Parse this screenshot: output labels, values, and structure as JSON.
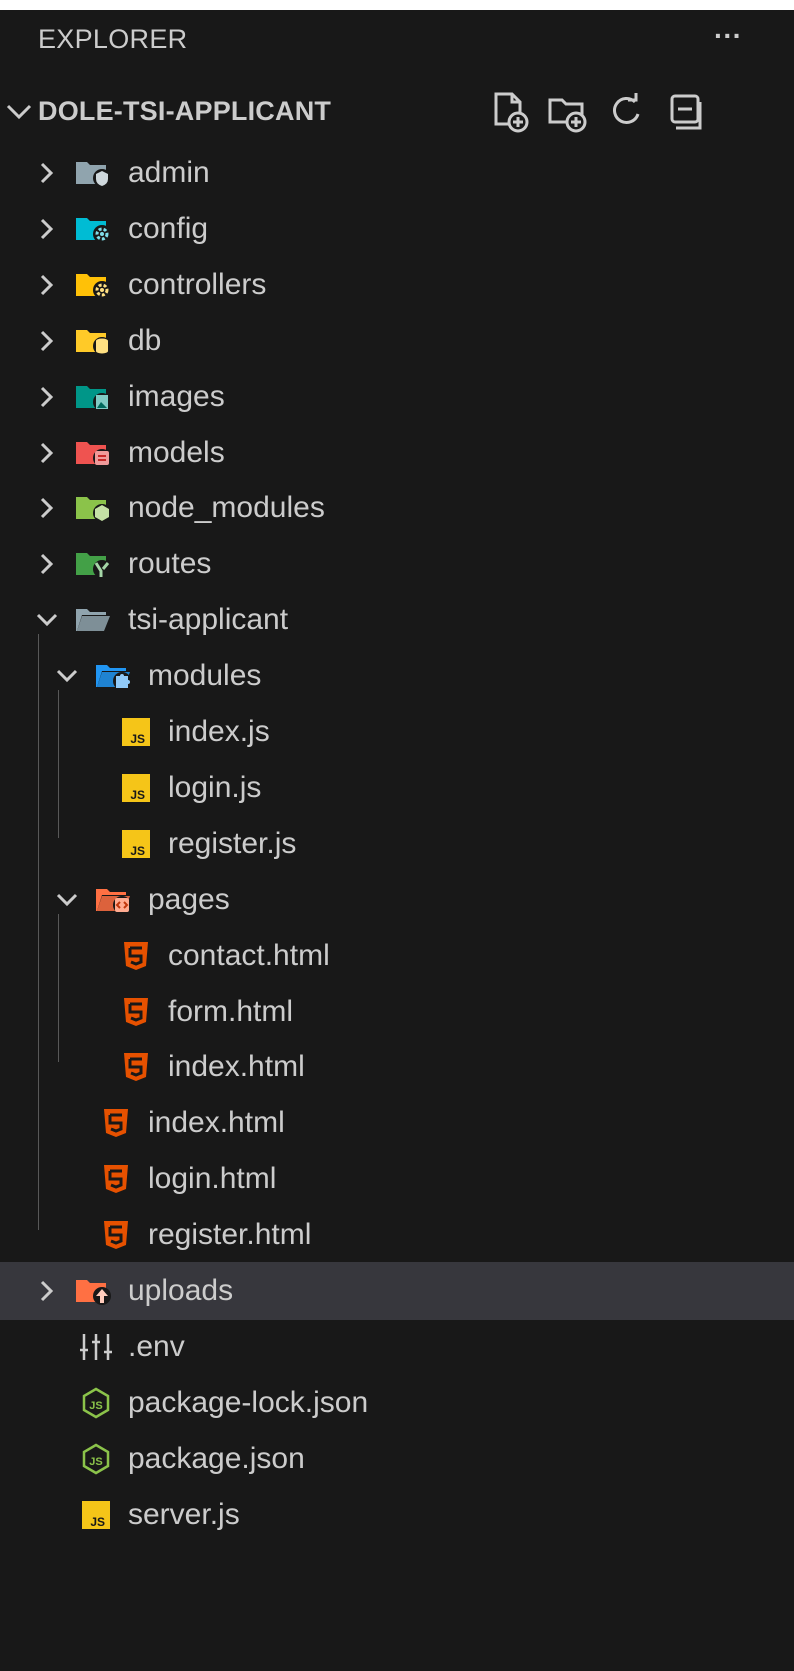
{
  "explorer": {
    "title": "EXPLORER",
    "more_icon": "ellipsis-icon",
    "more_glyph": "···"
  },
  "root": {
    "title": "DOLE-TSI-APPLICANT",
    "actions": [
      "new-file-icon",
      "new-folder-icon",
      "refresh-icon",
      "collapse-all-icon"
    ]
  },
  "tree": [
    {
      "label": "admin",
      "type": "folder",
      "icon": "folder-admin-icon",
      "expanded": false,
      "depth": 0
    },
    {
      "label": "config",
      "type": "folder",
      "icon": "folder-config-icon",
      "expanded": false,
      "depth": 0
    },
    {
      "label": "controllers",
      "type": "folder",
      "icon": "folder-controllers-icon",
      "expanded": false,
      "depth": 0
    },
    {
      "label": "db",
      "type": "folder",
      "icon": "folder-database-icon",
      "expanded": false,
      "depth": 0
    },
    {
      "label": "images",
      "type": "folder",
      "icon": "folder-images-icon",
      "expanded": false,
      "depth": 0
    },
    {
      "label": "models",
      "type": "folder",
      "icon": "folder-models-icon",
      "expanded": false,
      "depth": 0
    },
    {
      "label": "node_modules",
      "type": "folder",
      "icon": "folder-node-icon",
      "expanded": false,
      "depth": 0
    },
    {
      "label": "routes",
      "type": "folder",
      "icon": "folder-routes-icon",
      "expanded": false,
      "depth": 0
    },
    {
      "label": "tsi-applicant",
      "type": "folder",
      "icon": "folder-open-icon",
      "expanded": true,
      "depth": 0
    },
    {
      "label": "modules",
      "type": "folder",
      "icon": "folder-modules-icon",
      "expanded": true,
      "depth": 1
    },
    {
      "label": "index.js",
      "type": "file",
      "icon": "javascript-icon",
      "depth": 2
    },
    {
      "label": "login.js",
      "type": "file",
      "icon": "javascript-icon",
      "depth": 2
    },
    {
      "label": "register.js",
      "type": "file",
      "icon": "javascript-icon",
      "depth": 2
    },
    {
      "label": "pages",
      "type": "folder",
      "icon": "folder-pages-icon",
      "expanded": true,
      "depth": 1
    },
    {
      "label": "contact.html",
      "type": "file",
      "icon": "html-icon",
      "depth": 2
    },
    {
      "label": "form.html",
      "type": "file",
      "icon": "html-icon",
      "depth": 2
    },
    {
      "label": "index.html",
      "type": "file",
      "icon": "html-icon",
      "depth": 2
    },
    {
      "label": "index.html",
      "type": "file",
      "icon": "html-icon",
      "depth": 1
    },
    {
      "label": "login.html",
      "type": "file",
      "icon": "html-icon",
      "depth": 1
    },
    {
      "label": "register.html",
      "type": "file",
      "icon": "html-icon",
      "depth": 1
    },
    {
      "label": "uploads",
      "type": "folder",
      "icon": "folder-upload-icon",
      "expanded": false,
      "depth": 0,
      "selected": true
    },
    {
      "label": ".env",
      "type": "file",
      "icon": "env-settings-icon",
      "depth": 0
    },
    {
      "label": "package-lock.json",
      "type": "file",
      "icon": "nodejs-icon",
      "depth": 0
    },
    {
      "label": "package.json",
      "type": "file",
      "icon": "nodejs-icon",
      "depth": 0
    },
    {
      "label": "server.js",
      "type": "file",
      "icon": "javascript-icon",
      "depth": 0
    }
  ],
  "colors": {
    "background": "#181818",
    "selected_row": "#37373d",
    "text": "#cccccc",
    "folder_admin": "#90a4ae",
    "folder_config": "#00bcd4",
    "folder_controllers": "#ffc107",
    "folder_db": "#ffca28",
    "folder_images": "#009688",
    "folder_models": "#ef5350",
    "folder_node": "#8bc34a",
    "folder_routes": "#43a047",
    "folder_open": "#90a4ae",
    "folder_modules": "#2196f3",
    "folder_pages": "#ff7043",
    "folder_upload": "#ff7043",
    "js_badge": "#f5c518",
    "html_icon": "#e65100",
    "node_icon": "#8bc34a"
  }
}
